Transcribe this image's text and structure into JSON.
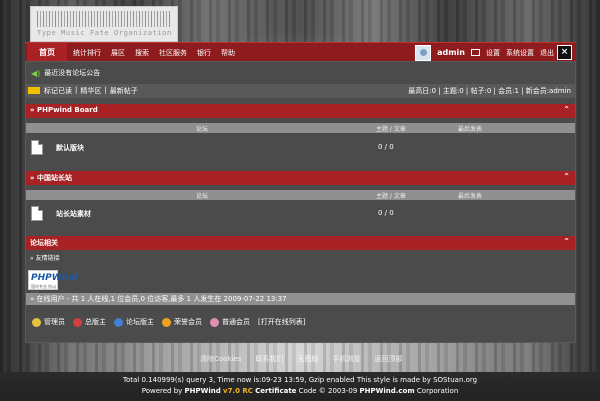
{
  "banner": {
    "logo_text": "Type Music Fate Organization"
  },
  "nav": {
    "home": "首页",
    "links": [
      "统计排行",
      "展区",
      "搜索",
      "社区服务",
      "银行",
      "帮助"
    ],
    "user": "admin",
    "settings": "设置",
    "system_settings": "系统设置",
    "logout": "退出",
    "close": "×"
  },
  "notice": {
    "text": "最近没有论坛公告"
  },
  "subbar": {
    "mark_read": "标记已读",
    "sep1": "|",
    "digest": "精华区",
    "sep2": "|",
    "new_posts": "最新帖子",
    "stats": "最高日:0 | 主题:0 | 帖子:0 | 会员:1 | 新会员:admin"
  },
  "sections": [
    {
      "title": "» PHPwind Board",
      "col_forum": "论坛",
      "col_topics": "主题 / 文章",
      "col_last": "最后发表",
      "forum_name": "默认版块",
      "forum_stat": "0 / 0"
    },
    {
      "title": "» 中国站长站",
      "col_forum": "论坛",
      "col_topics": "主题 / 文章",
      "col_last": "最后发表",
      "forum_name": "站长站素材",
      "forum_stat": "0 / 0"
    }
  ],
  "related": {
    "title": "论坛相关",
    "links_label": "» 友情链接",
    "pw_logo_main": "PHPWind",
    "pw_logo_sub": "国内专业 所以优秀",
    "online_text": "» 在线用户 - 共 1 人在线,1 位会员,0 位访客,最多 1 人发生在 2009-07-22 13:37"
  },
  "legend": {
    "items": [
      "管理员",
      "总版主",
      "论坛版主",
      "荣誉会员",
      "普通会员"
    ],
    "colors": [
      "#e8c040",
      "#d04040",
      "#4080d0",
      "#f0a020",
      "#e090b0"
    ],
    "open_list": "[打开在线列表]"
  },
  "bottom_links": [
    "清除Cookies",
    "联系我们",
    "无图版",
    "手机浏览",
    "返回顶部"
  ],
  "footer": {
    "line1": "Total 0.140999(s) query 3, Time now is:09-23 13:59, Gzip enabled     This style is made by SOStuan.org",
    "powered": "Powered by",
    "brand": "PHPWind",
    "version": "v7.0 RC",
    "cert": "Certificate",
    "code": "Code © 2003-09",
    "site": "PHPWind.com",
    "corp": "Corporation"
  }
}
